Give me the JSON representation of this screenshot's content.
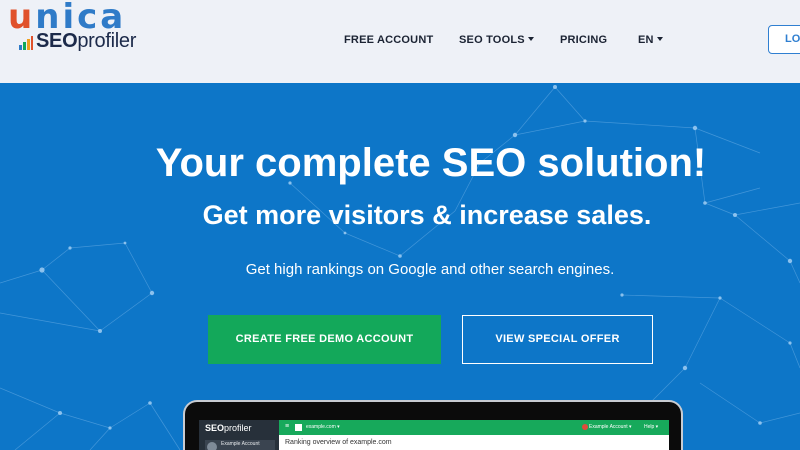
{
  "logo": {
    "letters": [
      "u",
      "n",
      "i",
      "c",
      "a"
    ],
    "letter_colors": [
      "#e0512b",
      "#2f7bc8",
      "#2f7bc8",
      "#2f7bc8",
      "#2f7bc8"
    ],
    "seo": "SEO",
    "profiler": "profiler"
  },
  "nav": {
    "free_account": "FREE ACCOUNT",
    "seo_tools": "SEO TOOLS",
    "pricing": "PRICING",
    "language": "EN",
    "login": "LO"
  },
  "hero": {
    "title": "Your complete SEO solution!",
    "subtitle": "Get more visitors & increase sales.",
    "description": "Get high rankings on Google and other search engines.",
    "cta_primary": "CREATE FREE DEMO ACCOUNT",
    "cta_secondary": "VIEW SPECIAL OFFER"
  },
  "preview": {
    "logo_bold": "SEO",
    "logo_rest": "profiler",
    "account_label": "Example Account",
    "menu_icon": "≡",
    "domain": "example.com ▾",
    "account_menu": "Example Account ▾",
    "help": "Help ▾",
    "page_title": "Ranking overview of example.com"
  },
  "colors": {
    "header_bg": "#eef1f7",
    "hero_bg": "#0d76c8",
    "cta_green": "#13a85a",
    "accent_blue": "#2f7fd1"
  }
}
